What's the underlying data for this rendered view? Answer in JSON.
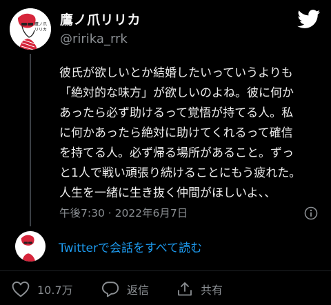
{
  "tweet": {
    "display_name": "鷹ノ爪リリカ",
    "handle": "@ririka_rrk",
    "body_lines": [
      "彼氏が欲しいとか結婚したいっていうよりも",
      "「絶対的な味方」が欲しいのよね。彼に何か",
      "あったら必ず助けるって覚悟が持てる人。私",
      "に何かあったら絶対に助けてくれるって確信",
      "を持てる人。必ず帰る場所があること。ずっ",
      "と1人で戦い頑張り続けることにもう疲れた。",
      "人生を一緒に生き抜く仲間がほしいよ、、"
    ],
    "timestamp": "午後7:30 · 2022年6月7日",
    "avatar_caption": "鷹ノ爪 リリカ"
  },
  "conversation": {
    "link_label": "Twitterで会話をすべて読む"
  },
  "actions": {
    "like_count": "10.7万",
    "reply_label": "返信",
    "share_label": "共有"
  },
  "icons": {
    "brand": "twitter-bird-icon",
    "info": "info-icon",
    "like": "heart-icon",
    "reply": "speech-bubble-icon",
    "share": "share-icon"
  },
  "colors": {
    "background": "#000000",
    "text": "#e7e9ea",
    "secondary_text": "#8b8f93",
    "link": "#1d9bf0",
    "avatar_accent": "#d6253b"
  }
}
